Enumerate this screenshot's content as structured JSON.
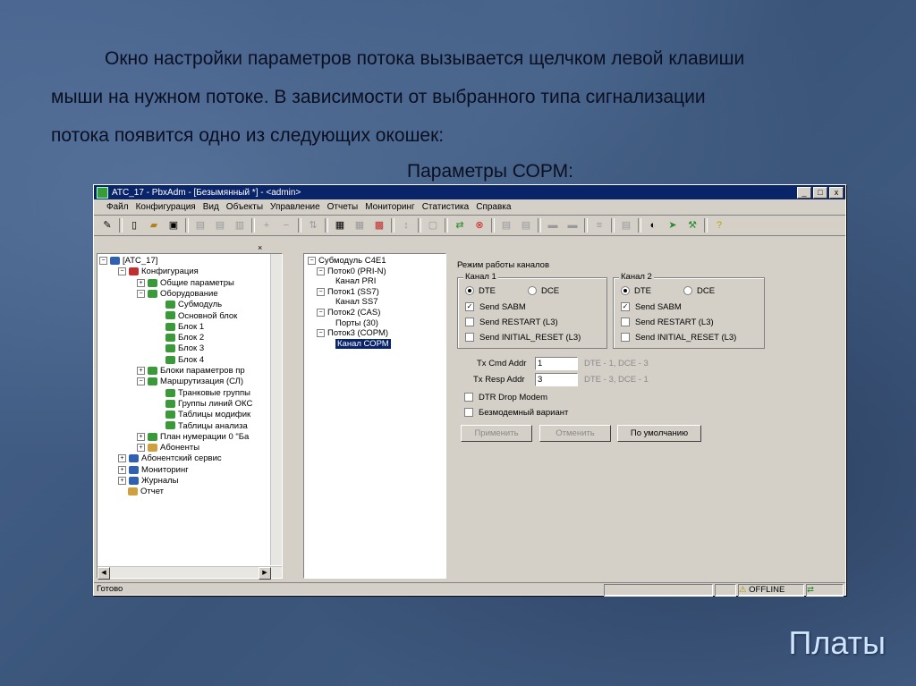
{
  "slide": {
    "paragraph_line1": "Окно настройки параметров потока вызывается щелчком левой клавиши",
    "paragraph_line2": "мыши на нужном потоке.  В  зависимости  от  выбранного  типа  сигнализации",
    "paragraph_line3": "потока  появится  одно  из  следующих окошек:",
    "caption": "Параметры СОРМ:",
    "footer_title": "Платы"
  },
  "window": {
    "title": "АТС_17 - PbxAdm - [Безымянный *]  - <admin>",
    "menu": [
      "Файл",
      "Конфигурация",
      "Вид",
      "Объекты",
      "Управление",
      "Отчеты",
      "Мониторинг",
      "Статистика",
      "Справка"
    ]
  },
  "tree_left": [
    {
      "label": "[АТС_17]",
      "level": 0,
      "exp": "−",
      "icon": "ic-b"
    },
    {
      "label": "Конфигурация",
      "level": 1,
      "exp": "−",
      "icon": "ic-r"
    },
    {
      "label": "Общие параметры",
      "level": 2,
      "exp": "+",
      "icon": "ic-g"
    },
    {
      "label": "Оборудование",
      "level": 2,
      "exp": "−",
      "icon": "ic-g"
    },
    {
      "label": "Субмодуль",
      "level": 3,
      "exp": "",
      "icon": "ic-g"
    },
    {
      "label": "Основной блок",
      "level": 3,
      "exp": "",
      "icon": "ic-g"
    },
    {
      "label": "Блок 1",
      "level": 3,
      "exp": "",
      "icon": "ic-g"
    },
    {
      "label": "Блок 2",
      "level": 3,
      "exp": "",
      "icon": "ic-g"
    },
    {
      "label": "Блок 3",
      "level": 3,
      "exp": "",
      "icon": "ic-g"
    },
    {
      "label": "Блок 4",
      "level": 3,
      "exp": "",
      "icon": "ic-g"
    },
    {
      "label": "Блоки параметров пр",
      "level": 2,
      "exp": "+",
      "icon": "ic-g"
    },
    {
      "label": "Маршрутизация (СЛ)",
      "level": 2,
      "exp": "−",
      "icon": "ic-g"
    },
    {
      "label": "Транковые группы",
      "level": 3,
      "exp": "",
      "icon": "ic-g"
    },
    {
      "label": "Группы линий ОКС",
      "level": 3,
      "exp": "",
      "icon": "ic-g"
    },
    {
      "label": "Таблицы модифик",
      "level": 3,
      "exp": "",
      "icon": "ic-g"
    },
    {
      "label": "Таблицы анализа",
      "level": 3,
      "exp": "",
      "icon": "ic-g"
    },
    {
      "label": "План нумерации 0 \"Ба",
      "level": 2,
      "exp": "+",
      "icon": "ic-g"
    },
    {
      "label": "Абоненты",
      "level": 2,
      "exp": "+",
      "icon": "ic-y"
    },
    {
      "label": "Абонентский сервис",
      "level": 1,
      "exp": "+",
      "icon": "ic-b"
    },
    {
      "label": "Мониторинг",
      "level": 1,
      "exp": "+",
      "icon": "ic-b"
    },
    {
      "label": "Журналы",
      "level": 1,
      "exp": "+",
      "icon": "ic-b"
    },
    {
      "label": "Отчет",
      "level": 1,
      "exp": "",
      "icon": "ic-y"
    }
  ],
  "tree_mid": [
    {
      "label": "Субмодуль С4Е1",
      "level": 0,
      "exp": "−"
    },
    {
      "label": "Поток0 (PRI-N)",
      "level": 1,
      "exp": "−"
    },
    {
      "label": "Канал PRI",
      "level": 2,
      "exp": ""
    },
    {
      "label": "Поток1 (SS7)",
      "level": 1,
      "exp": "−"
    },
    {
      "label": "Канал SS7",
      "level": 2,
      "exp": ""
    },
    {
      "label": "Поток2 (CAS)",
      "level": 1,
      "exp": "−"
    },
    {
      "label": "Порты (30)",
      "level": 2,
      "exp": ""
    },
    {
      "label": "Поток3 (СОРМ)",
      "level": 1,
      "exp": "−"
    },
    {
      "label": "Канал СОРМ",
      "level": 2,
      "exp": "",
      "selected": true
    }
  ],
  "settings": {
    "mode_label": "Режим работы каналов",
    "ch1": {
      "title": "Канал 1",
      "dte": "DTE",
      "dce": "DCE",
      "sabm": "Send SABM",
      "restart": "Send RESTART (L3)",
      "initial": "Send INITIAL_RESET (L3)"
    },
    "ch2": {
      "title": "Канал 2",
      "dte": "DTE",
      "dce": "DCE",
      "sabm": "Send SABM",
      "restart": "Send RESTART (L3)",
      "initial": "Send INITIAL_RESET (L3)"
    },
    "tx_cmd_label": "Tx Cmd Addr",
    "tx_cmd_value": "1",
    "tx_cmd_hint": "DTE - 1,  DCE - 3",
    "tx_resp_label": "Tx Resp Addr",
    "tx_resp_value": "3",
    "tx_resp_hint": "DTE - 3,  DCE - 1",
    "dtr": "DTR Drop Modem",
    "modemless": "Безмодемный вариант",
    "apply": "Применить",
    "cancel": "Отменить",
    "defaults": "По умолчанию"
  },
  "status": {
    "ready": "Готово",
    "offline": "OFFLINE"
  }
}
